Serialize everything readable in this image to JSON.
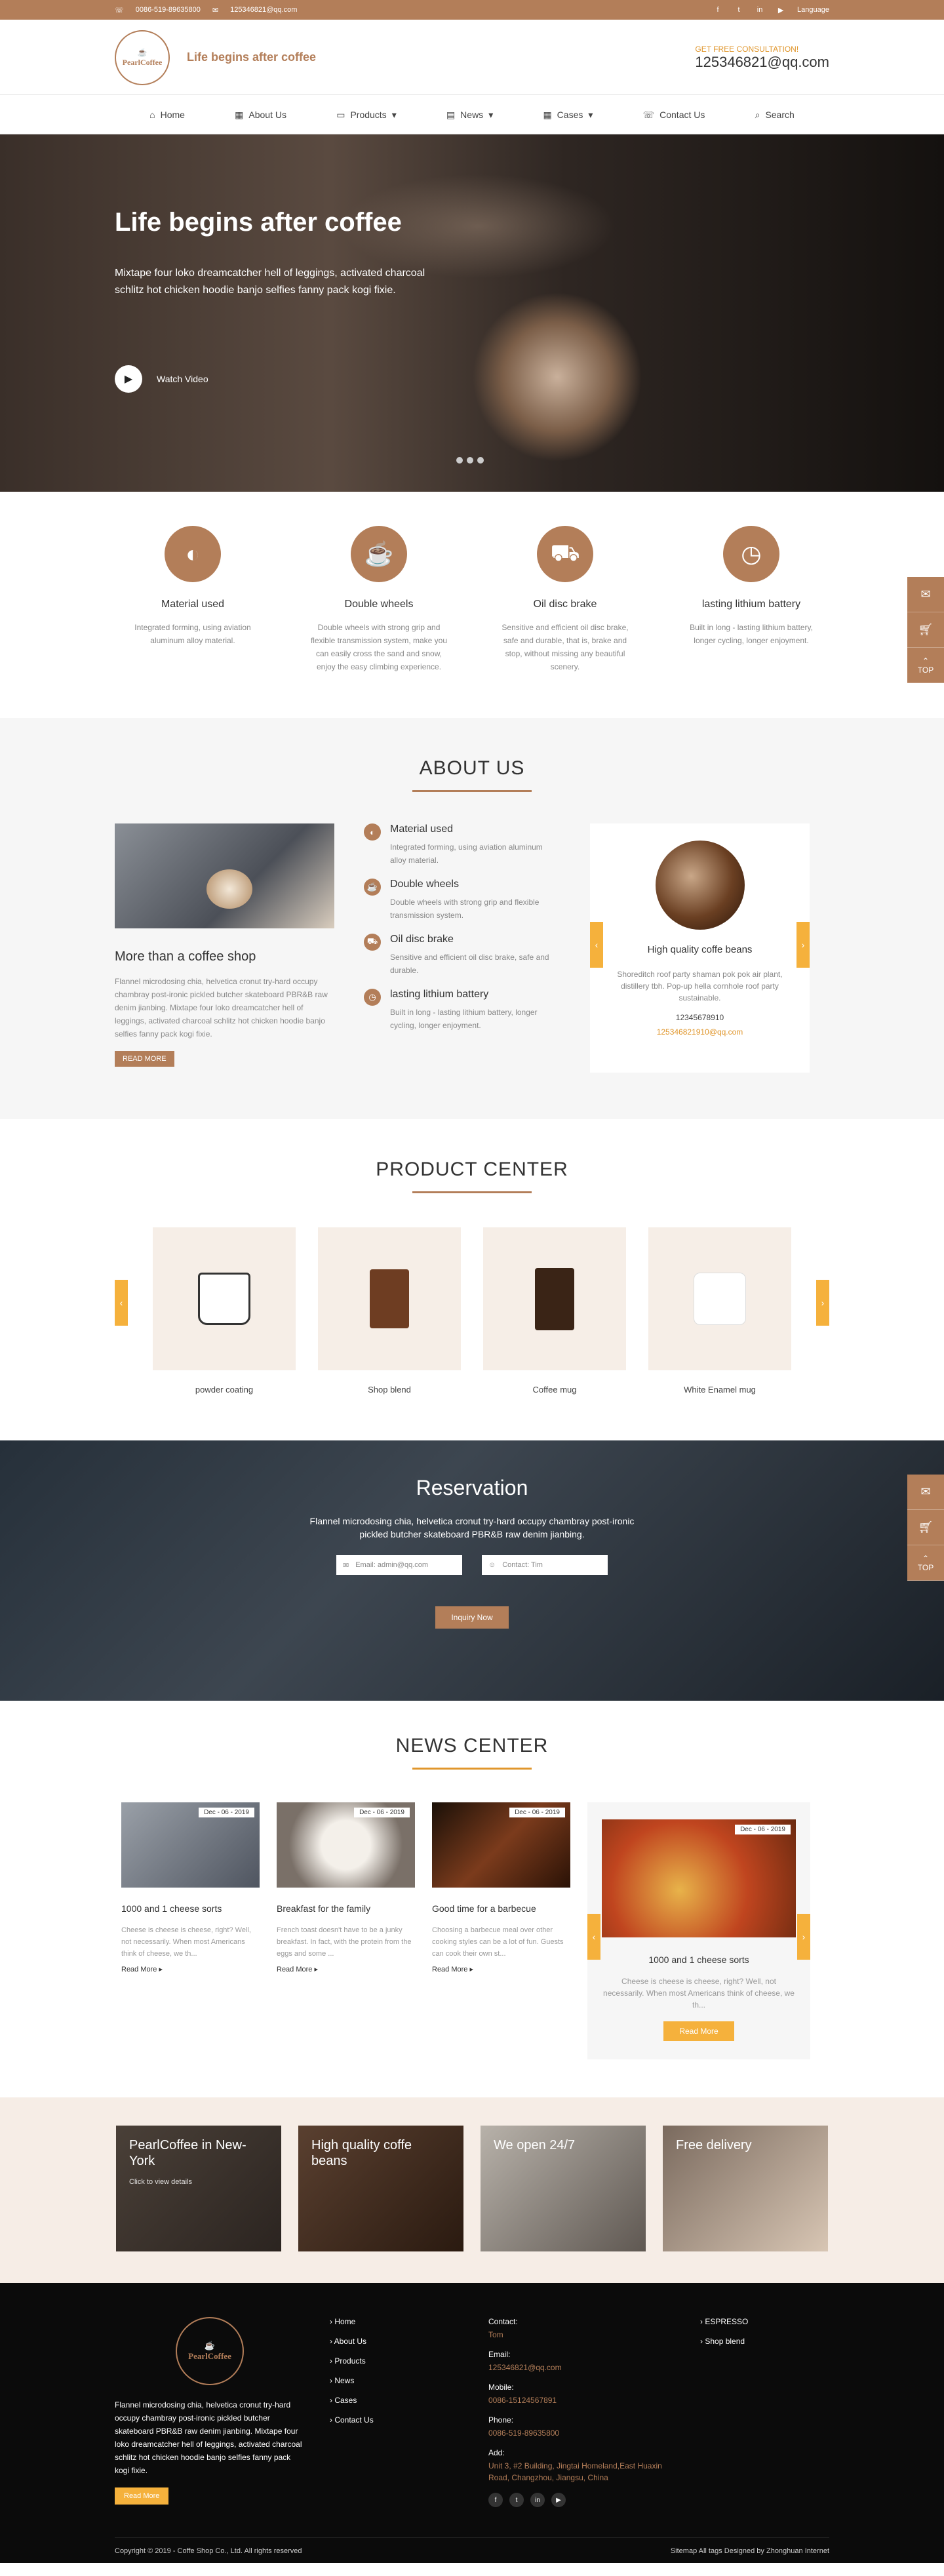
{
  "topbar": {
    "phone": "0086-519-89635800",
    "email": "125346821@qq.com",
    "language": "Language"
  },
  "header": {
    "logo_text": "PearlCoffee",
    "slogan": "Life begins after coffee",
    "consult_label": "GET FREE CONSULTATION!",
    "consult_email": "125346821@qq.com"
  },
  "nav": [
    "Home",
    "About Us",
    "Products",
    "News",
    "Cases",
    "Contact Us",
    "Search"
  ],
  "hero": {
    "title": "Life begins after coffee",
    "text": "Mixtape four loko dreamcatcher hell of leggings, activated charcoal schlitz hot chicken hoodie banjo selfies fanny pack kogi fixie.",
    "watch": "Watch Video"
  },
  "features": [
    {
      "title": "Material used",
      "text": "Integrated forming, using aviation aluminum alloy material."
    },
    {
      "title": "Double wheels",
      "text": "Double wheels with strong grip and flexible transmission system, make you can easily cross the sand and snow, enjoy the easy climbing experience."
    },
    {
      "title": "Oil disc brake",
      "text": "Sensitive and efficient oil disc brake, safe and durable, that is, brake and stop, without missing any beautiful scenery."
    },
    {
      "title": "lasting lithium battery",
      "text": "Built in long - lasting lithium battery, longer cycling, longer enjoyment."
    }
  ],
  "about": {
    "title": "ABOUT US",
    "heading": "More than a coffee shop",
    "text": "Flannel microdosing chia, helvetica cronut try-hard occupy chambray post-ironic pickled butcher skateboard PBR&B raw denim jianbing. Mixtape four loko dreamcatcher hell of leggings, activated charcoal schlitz hot chicken hoodie banjo selfies fanny pack kogi fixie.",
    "read_more": "READ MORE",
    "items": [
      {
        "title": "Material used",
        "text": "Integrated forming, using aviation aluminum alloy material."
      },
      {
        "title": "Double wheels",
        "text": "Double wheels with strong grip and flexible transmission system."
      },
      {
        "title": "Oil disc brake",
        "text": "Sensitive and efficient oil disc brake, safe and durable."
      },
      {
        "title": "lasting lithium battery",
        "text": "Built in long - lasting lithium battery, longer cycling, longer enjoyment."
      }
    ],
    "card": {
      "title": "High quality coffe beans",
      "text": "Shoreditch roof party shaman pok pok air plant, distillery tbh. Pop-up hella cornhole roof party sustainable.",
      "phone": "12345678910",
      "email": "125346821910@qq.com"
    }
  },
  "product": {
    "title": "PRODUCT CENTER",
    "items": [
      "powder coating",
      "Shop blend",
      "Coffee mug",
      "White Enamel mug"
    ]
  },
  "reservation": {
    "title": "Reservation",
    "text": "Flannel microdosing chia, helvetica cronut try-hard occupy chambray post-ironic pickled butcher skateboard PBR&B raw denim jianbing.",
    "email_placeholder": "Email: admin@qq.com",
    "contact_placeholder": "Contact: Tim",
    "button": "Inquiry Now"
  },
  "news": {
    "title": "NEWS CENTER",
    "items": [
      {
        "date": "Dec - 06 - 2019",
        "title": "1000 and 1 cheese sorts",
        "text": "Cheese is cheese is cheese, right? Well, not necessarily. When most Americans think of cheese, we th...",
        "more": "Read More"
      },
      {
        "date": "Dec - 06 - 2019",
        "title": "Breakfast for the family",
        "text": "French toast doesn't have to be a junky breakfast. In fact, with the protein from the eggs and some ...",
        "more": "Read More"
      },
      {
        "date": "Dec - 06 - 2019",
        "title": "Good time for a barbecue",
        "text": "Choosing a barbecue meal over other cooking styles can be a lot of fun. Guests can cook their own st...",
        "more": "Read More"
      }
    ],
    "featured": {
      "date": "Dec - 06 - 2019",
      "title": "1000 and 1 cheese sorts",
      "text": "Cheese is cheese is cheese, right? Well, not necessarily. When most Americans think of cheese, we th...",
      "button": "Read More"
    }
  },
  "promo": [
    {
      "title": "PearlCoffee in New-York",
      "cta": "Click to view details"
    },
    {
      "title": "High quality coffe beans",
      "cta": ""
    },
    {
      "title": "We open 24/7",
      "cta": ""
    },
    {
      "title": "Free delivery",
      "cta": ""
    }
  ],
  "footer": {
    "text": "Flannel microdosing chia, helvetica cronut try-hard occupy chambray post-ironic pickled butcher skateboard PBR&B raw denim jianbing. Mixtape four loko dreamcatcher hell of leggings, activated charcoal schlitz hot chicken hoodie banjo selfies fanny pack kogi fixie.",
    "button": "Read More",
    "links": [
      "Home",
      "About Us",
      "Products",
      "News",
      "Cases",
      "Contact Us"
    ],
    "contact_label": "Contact:",
    "contact": "Tom",
    "email_label": "Email:",
    "email": "125346821@qq.com",
    "mobile_label": "Mobile:",
    "mobile": "0086-15124567891",
    "phone_label": "Phone:",
    "phone": "0086-519-89635800",
    "add_label": "Add:",
    "add": "Unit 3, #2 Building, Jingtai Homeland,East Huaxin Road, Changzhou, Jiangsu, China",
    "cats": [
      "ESPRESSO",
      "Shop blend"
    ],
    "copyright": "Copyright © 2019 - Coffe Shop Co., Ltd. All rights reserved",
    "bottom_links": "Sitemap All tags Designed by Zhonghuan Internet"
  },
  "side": {
    "top": "TOP"
  }
}
